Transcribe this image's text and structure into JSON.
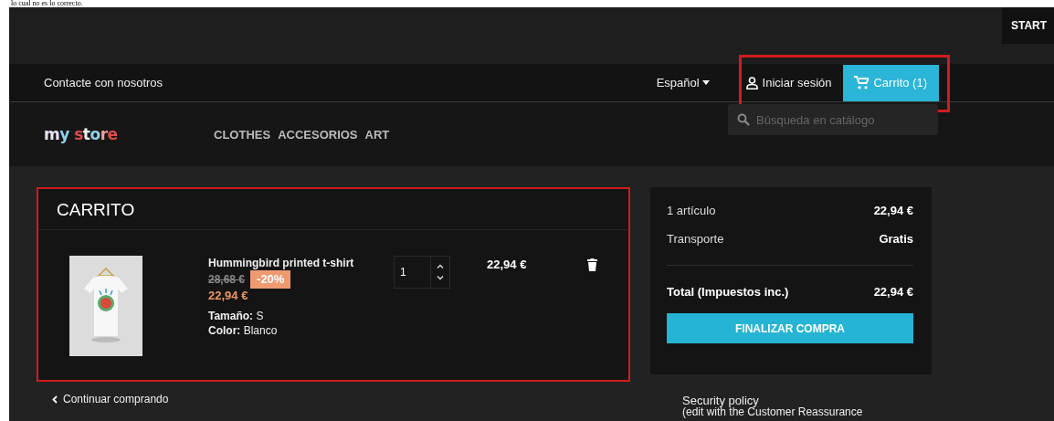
{
  "caption": "lo cual no es lo correcto.",
  "top_bar": {
    "button": "START"
  },
  "nav": {
    "contact": "Contacte con nosotros",
    "language": "Español",
    "login": "Iniciar sesión",
    "cart": "Carrito (1)",
    "highlighted": true
  },
  "header": {
    "logo": "my store",
    "menu": [
      "CLOTHES",
      "ACCESORIOS",
      "ART"
    ],
    "search": {
      "placeholder": "Búsqueda en catálogo"
    }
  },
  "cart": {
    "title": "CARRITO",
    "highlighted": true,
    "items": [
      {
        "name": "Hummingbird printed t-shirt",
        "old_price": "28,68 €",
        "discount": "-20%",
        "price": "22,94 €",
        "attributes": [
          {
            "label": "Tamaño:",
            "value": "S"
          },
          {
            "label": "Color:",
            "value": "Blanco"
          }
        ],
        "quantity": "1",
        "total": "22,94 €"
      }
    ],
    "continue": "Continuar comprando"
  },
  "summary": {
    "lines": [
      {
        "label": "1 artículo",
        "value": "22,94 €"
      },
      {
        "label": "Transporte",
        "value": "Gratis"
      }
    ],
    "total": {
      "label": "Total (Impuestos inc.)",
      "value": "22,94 €"
    },
    "checkout": "FINALIZAR COMPRA"
  },
  "reassurance": {
    "title": "Security policy",
    "text": "(edit with the Customer Reassurance"
  }
}
